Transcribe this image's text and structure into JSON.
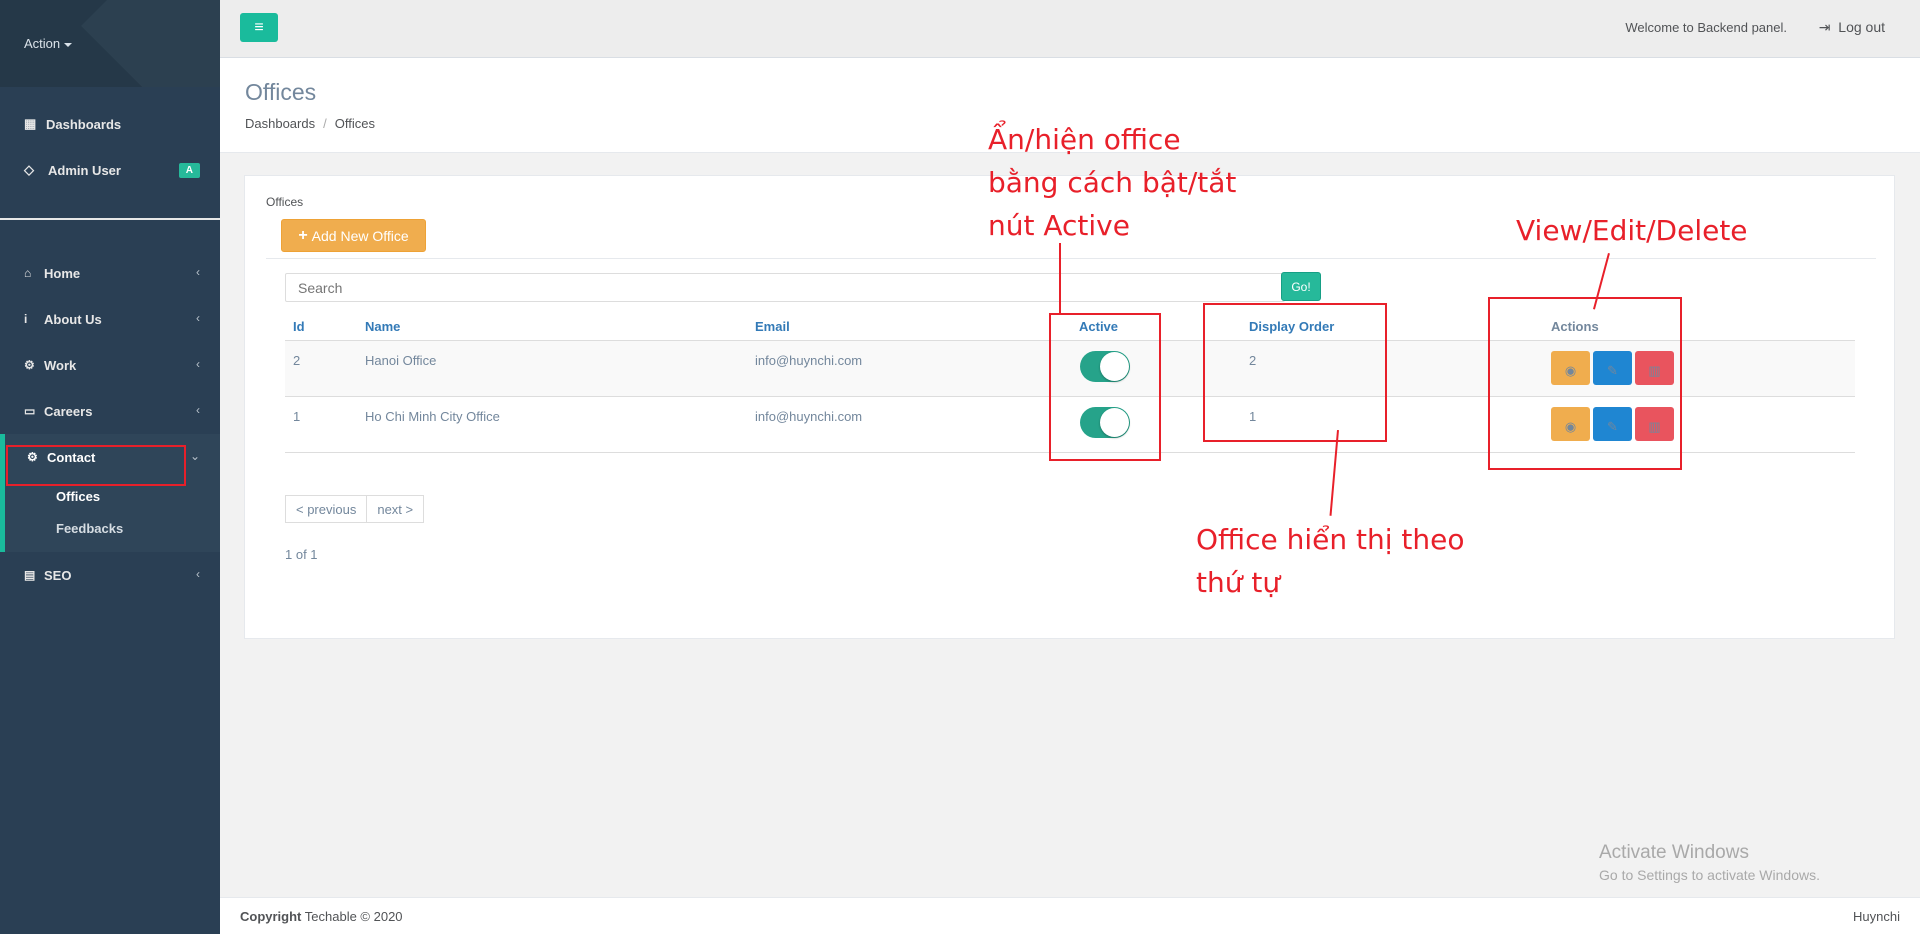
{
  "sidebar": {
    "action_label": "Action",
    "profile": [
      {
        "icon": "dashboard-icon",
        "glyph": "▦",
        "label": "Dashboards"
      },
      {
        "icon": "diamond-icon",
        "glyph": "◇",
        "label": "Admin User",
        "badge": "A"
      }
    ],
    "menu": [
      {
        "icon": "home-icon",
        "glyph": "⌂",
        "label": "Home"
      },
      {
        "icon": "info-icon",
        "glyph": "i",
        "label": "About Us"
      },
      {
        "icon": "work-icon",
        "glyph": "⚙",
        "label": "Work"
      },
      {
        "icon": "careers-icon",
        "glyph": "▭",
        "label": "Careers"
      }
    ],
    "contact": {
      "icon": "contact-icon",
      "glyph": "⚙",
      "label": "Contact",
      "subitems": [
        "Offices",
        "Feedbacks"
      ]
    },
    "seo": {
      "icon": "seo-icon",
      "glyph": "▤",
      "label": "SEO"
    }
  },
  "topbar": {
    "welcome": "Welcome to Backend panel.",
    "logout": "Log out"
  },
  "page": {
    "title": "Offices",
    "breadcrumb": [
      "Dashboards",
      "Offices"
    ]
  },
  "panel": {
    "title": "Offices",
    "add_button": "Add New Office",
    "search_placeholder": "Search",
    "go_button": "Go!",
    "columns": [
      "Id",
      "Name",
      "Email",
      "Active",
      "Display Order",
      "Actions"
    ],
    "rows": [
      {
        "id": "2",
        "name": "Hanoi Office",
        "email": "info@huynchi.com",
        "active": true,
        "display_order": "2"
      },
      {
        "id": "1",
        "name": "Ho Chi Minh City Office",
        "email": "info@huynchi.com",
        "active": true,
        "display_order": "1"
      }
    ],
    "pager": {
      "previous": "< previous",
      "next": "next >"
    },
    "count": "1 of 1"
  },
  "annotations": {
    "active_note": [
      "Ẩn/hiện office",
      "bằng cách bật/tắt",
      "nút Active"
    ],
    "actions_note": "View/Edit/Delete",
    "order_note": [
      "Office hiển thị theo",
      "thứ tự"
    ],
    "color": "#e8202a"
  },
  "watermark": {
    "line1": "Activate Windows",
    "line2": "Go to Settings to activate Windows."
  },
  "footer": {
    "copyright_bold": "Copyright",
    "copyright_rest": "Techable © 2020",
    "right": "Huynchi"
  }
}
